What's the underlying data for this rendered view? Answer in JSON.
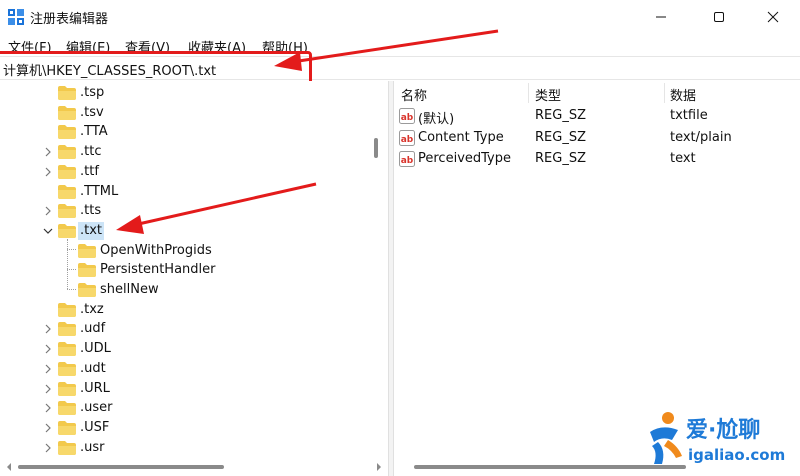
{
  "window": {
    "title": "注册表编辑器",
    "icon": "registry-icon",
    "controls": {
      "minimize": "minimize-icon",
      "maximize": "maximize-icon",
      "close": "close-icon"
    }
  },
  "menu": {
    "items": [
      "文件(F)",
      "编辑(E)",
      "查看(V)",
      "收藏夹(A)",
      "帮助(H)"
    ]
  },
  "address": {
    "path": "计算机\\HKEY_CLASSES_ROOT\\.txt"
  },
  "tree": {
    "nodes": [
      {
        "label": ".tsp",
        "expander": "none"
      },
      {
        "label": ".tsv",
        "expander": "none"
      },
      {
        "label": ".TTA",
        "expander": "none"
      },
      {
        "label": ".ttc",
        "expander": "collapsed"
      },
      {
        "label": ".ttf",
        "expander": "collapsed"
      },
      {
        "label": ".TTML",
        "expander": "none"
      },
      {
        "label": ".tts",
        "expander": "collapsed"
      },
      {
        "label": ".txt",
        "expander": "expanded",
        "selected": true
      },
      {
        "label": "OpenWithProgids",
        "expander": "none",
        "child": true
      },
      {
        "label": "PersistentHandler",
        "expander": "none",
        "child": true
      },
      {
        "label": "shellNew",
        "expander": "none",
        "child": true
      },
      {
        "label": ".txz",
        "expander": "none"
      },
      {
        "label": ".udf",
        "expander": "collapsed"
      },
      {
        "label": ".UDL",
        "expander": "collapsed"
      },
      {
        "label": ".udt",
        "expander": "collapsed"
      },
      {
        "label": ".URL",
        "expander": "collapsed"
      },
      {
        "label": ".user",
        "expander": "collapsed"
      },
      {
        "label": ".USF",
        "expander": "collapsed"
      },
      {
        "label": ".usr",
        "expander": "collapsed"
      }
    ]
  },
  "values": {
    "columns": [
      "名称",
      "类型",
      "数据"
    ],
    "rows": [
      {
        "name": "(默认)",
        "type": "REG_SZ",
        "data": "txtfile",
        "icon": "string-value-icon"
      },
      {
        "name": "Content Type",
        "type": "REG_SZ",
        "data": "text/plain",
        "icon": "string-value-icon"
      },
      {
        "name": "PerceivedType",
        "type": "REG_SZ",
        "data": "text",
        "icon": "string-value-icon"
      }
    ]
  },
  "colors": {
    "annotation_red": "#e31b1b",
    "selection": "#cce4f7",
    "folder": "#f2c94c",
    "watermark_blue": "#1e7ad7",
    "watermark_orange": "#f08a1c"
  },
  "watermark": {
    "brand": "爱·尬聊",
    "domain": "igaliao.com"
  }
}
